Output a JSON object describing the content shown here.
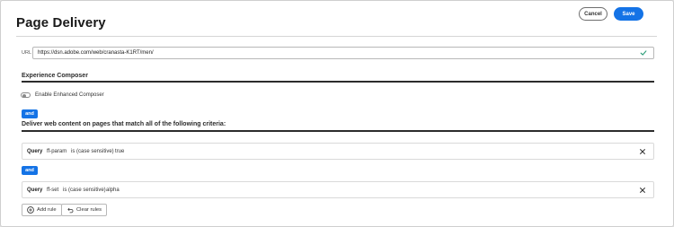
{
  "header": {
    "title": "Page Delivery",
    "cancel_label": "Cancel",
    "save_label": "Save"
  },
  "url": {
    "label": "URL",
    "value": "https://dsn.adobe.com/web/cranasta-K1RT/men/",
    "valid_icon": "check-icon"
  },
  "experience_composer": {
    "title": "Experience Composer",
    "toggle_label": "Enable Enhanced Composer",
    "enabled": false
  },
  "criteria": {
    "and_label_1": "and",
    "title": "Deliver web content on pages that match all of the following criteria:",
    "and_label_2": "and",
    "rules": [
      {
        "type": "Query",
        "param": "ff-param",
        "operator": "is (case sensitive)",
        "value": "true"
      },
      {
        "type": "Query",
        "param": "ff-set",
        "operator": "is (case sensitive)",
        "value": "alpha"
      }
    ]
  },
  "footer": {
    "add_rule_label": "Add rule",
    "clear_rules_label": "Clear rules"
  },
  "colors": {
    "accent": "#1473e6",
    "valid": "#2d9d78"
  }
}
